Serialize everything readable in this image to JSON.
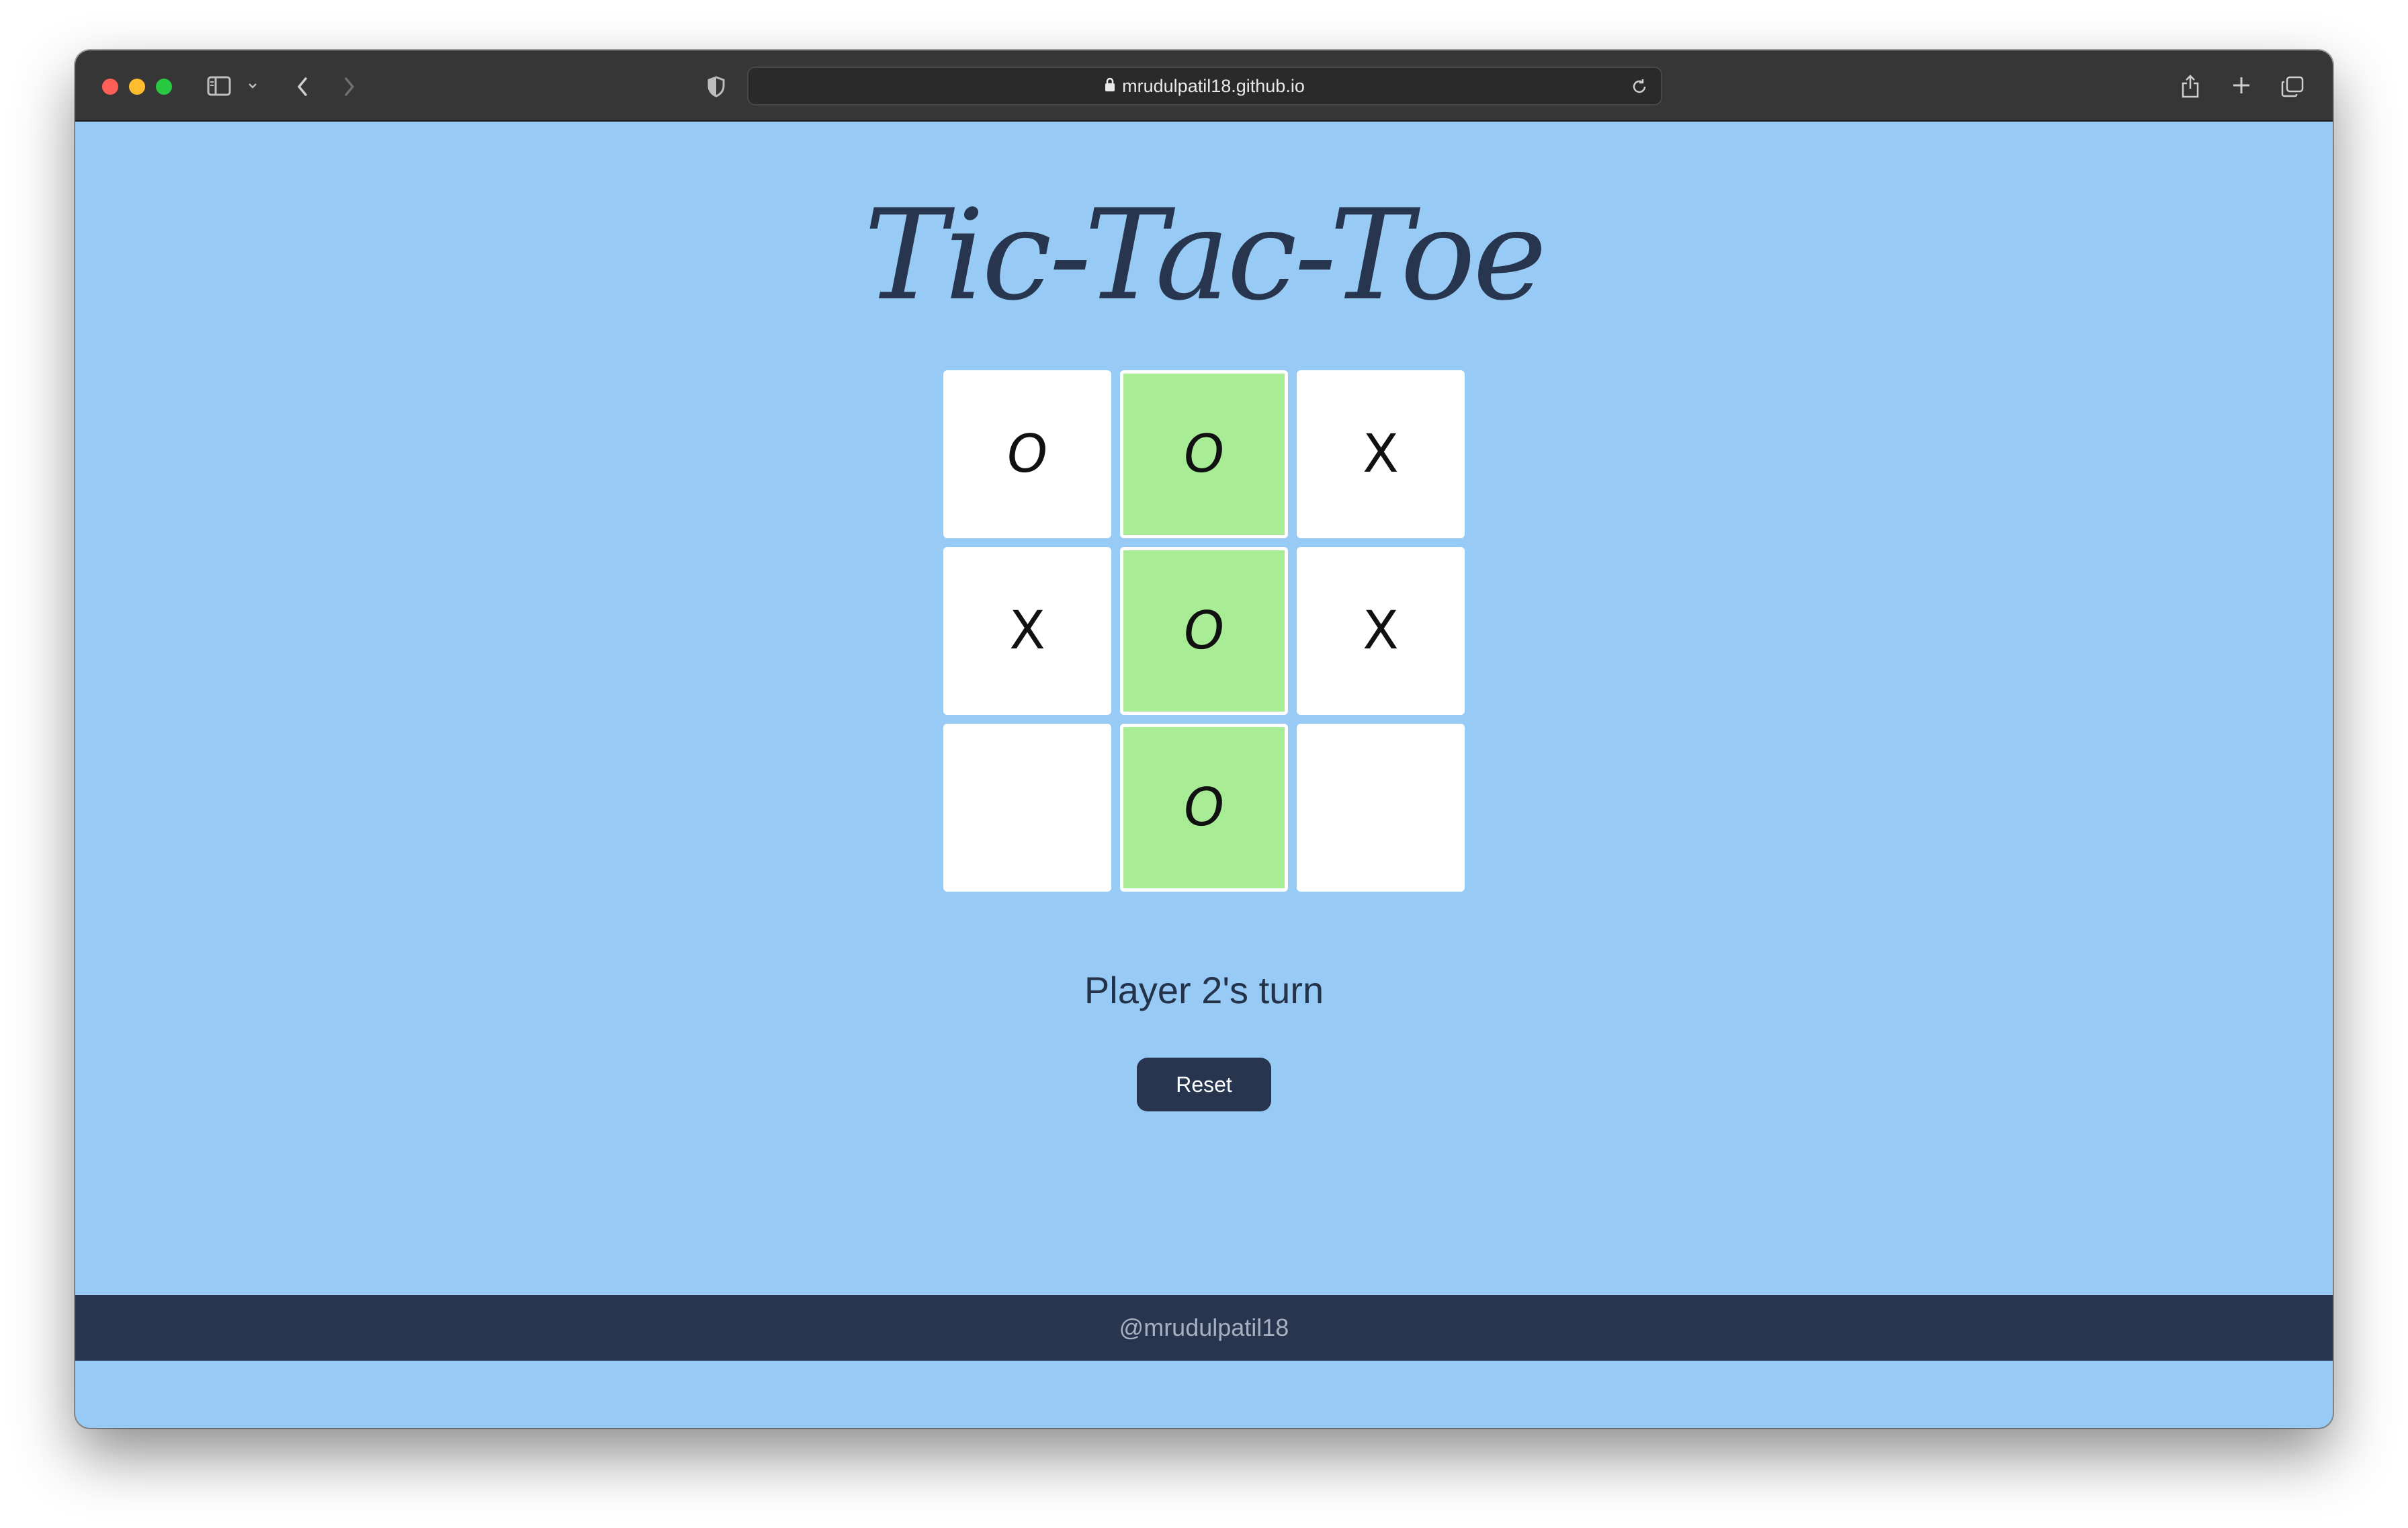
{
  "browser": {
    "url": "mrudulpatil18.github.io",
    "icons": {
      "sidebar": "sidebar-icon",
      "chevron": "chevron-down-icon",
      "back": "chevron-left-icon",
      "forward": "chevron-right-icon",
      "privacy": "shield-icon",
      "lock": "lock-icon",
      "reload": "reload-icon",
      "share": "share-icon",
      "new_tab": "plus-icon",
      "tabs": "tabs-overview-icon"
    }
  },
  "game": {
    "title": "Tic-Tac-Toe",
    "board": [
      {
        "mark": "O",
        "winning": false
      },
      {
        "mark": "O",
        "winning": true
      },
      {
        "mark": "X",
        "winning": false
      },
      {
        "mark": "X",
        "winning": false
      },
      {
        "mark": "O",
        "winning": true
      },
      {
        "mark": "X",
        "winning": false
      },
      {
        "mark": "",
        "winning": false
      },
      {
        "mark": "O",
        "winning": true
      },
      {
        "mark": "",
        "winning": false
      }
    ],
    "status": "Player 2's turn",
    "reset_label": "Reset"
  },
  "footer": {
    "handle": "@mrudulpatil18"
  },
  "colors": {
    "page_background": "#97caf4",
    "accent_dark": "#28354e",
    "winning_cell": "#a9ec96",
    "cell": "#ffffff"
  }
}
